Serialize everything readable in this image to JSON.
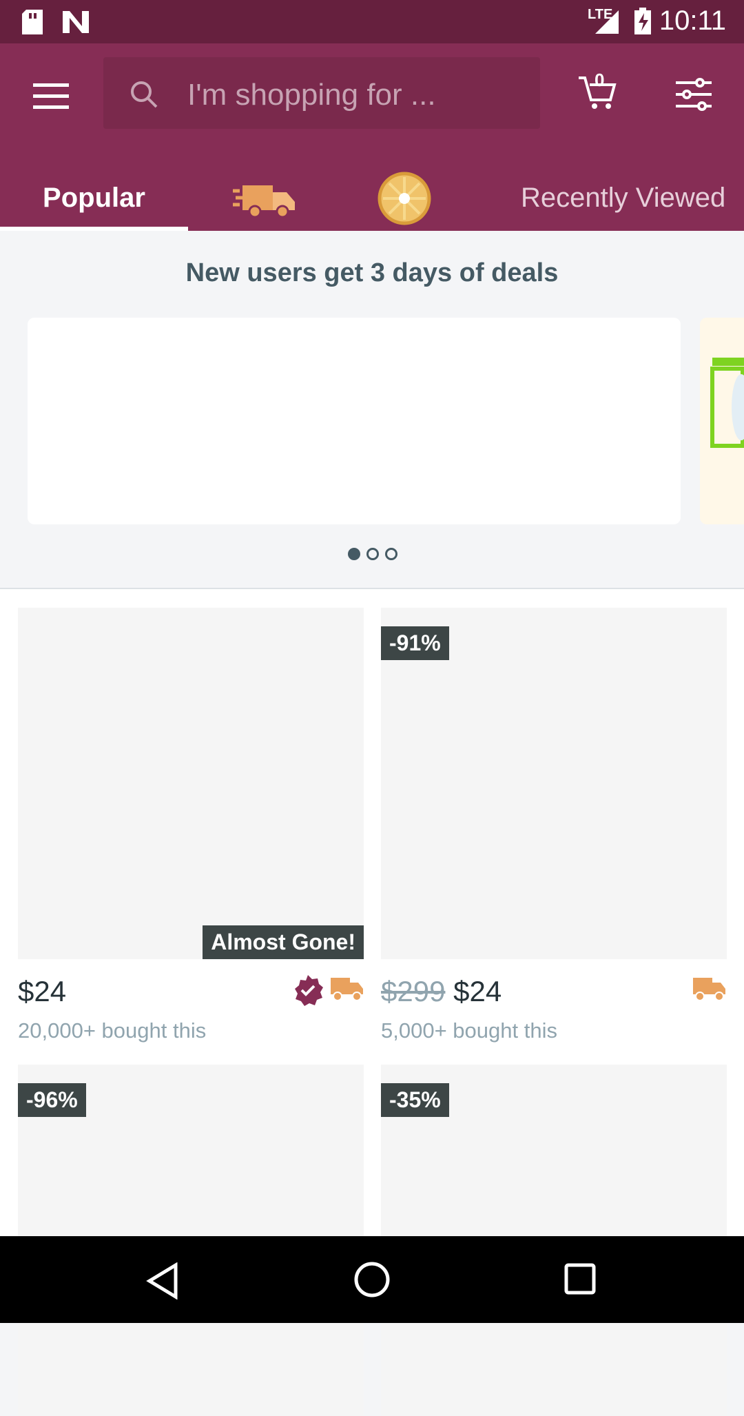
{
  "status_bar": {
    "network": "LTE",
    "time": "10:11"
  },
  "header": {
    "search_placeholder": "I'm shopping for ...",
    "cart_count": "0"
  },
  "tabs": [
    {
      "label": "Popular"
    },
    {
      "label": "fast-delivery-icon"
    },
    {
      "label": "reward-wheel-icon"
    },
    {
      "label": "Recently Viewed"
    }
  ],
  "promo": {
    "title": "New users get 3 days of deals",
    "carousel_pages": 3,
    "active_page": 1
  },
  "products": [
    {
      "price": "$24",
      "bought": "20,000+ bought this",
      "status": "Almost Gone!"
    },
    {
      "discount": "-91%",
      "original_price": "$299",
      "price": "$24",
      "bought": "5,000+ bought this"
    },
    {
      "discount": "-96%"
    },
    {
      "discount": "-35%"
    }
  ],
  "colors": {
    "brand": "#862d55",
    "dark_brand": "#66203e",
    "truck": "#e9a15d"
  }
}
